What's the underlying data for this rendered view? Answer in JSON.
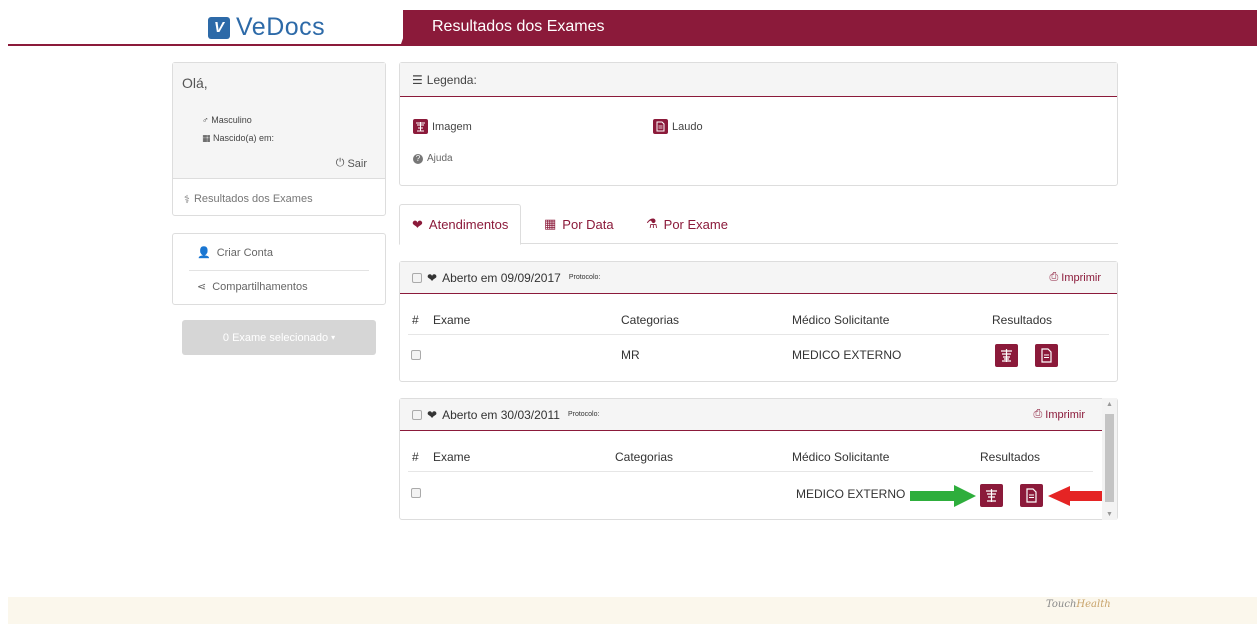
{
  "header": {
    "logo_text": "VeDocs",
    "page_title": "Resultados dos Exames",
    "accent_color": "#8b1a3a",
    "logo_color": "#2d6aa8"
  },
  "sidebar": {
    "greeting": "Olá,",
    "gender_label": "Masculino",
    "born_label": "Nascido(a) em:",
    "logout_label": "Sair",
    "results_link": "Resultados dos Exames",
    "menu": [
      {
        "label": "Criar Conta",
        "icon": "add-user-icon"
      },
      {
        "label": "Compartilhamentos",
        "icon": "share-icon"
      }
    ],
    "selected_button": "0 Exame selecionado"
  },
  "legend": {
    "title": "Legenda:",
    "items": [
      {
        "label": "Imagem",
        "icon": "image-icon"
      },
      {
        "label": "Laudo",
        "icon": "report-icon"
      },
      {
        "label": "Ajuda",
        "icon": "help-icon"
      }
    ]
  },
  "tabs": [
    {
      "label": "Atendimentos",
      "icon": "heartbeat-icon",
      "active": true
    },
    {
      "label": "Por Data",
      "icon": "calendar-icon",
      "active": false
    },
    {
      "label": "Por Exame",
      "icon": "flask-icon",
      "active": false
    }
  ],
  "cards": [
    {
      "title": "Aberto em 09/09/2017",
      "protocol_label": "Protocolo:",
      "print_label": "Imprimir",
      "columns": [
        "#",
        "Exame",
        "Categorias",
        "Médico Solicitante",
        "Resultados"
      ],
      "rows": [
        {
          "exam": "",
          "category": "MR",
          "doctor": "MEDICO EXTERNO"
        }
      ]
    },
    {
      "title": "Aberto em 30/03/2011",
      "protocol_label": "Protocolo:",
      "print_label": "Imprimir",
      "columns": [
        "#",
        "Exame",
        "Categorias",
        "Médico Solicitante",
        "Resultados"
      ],
      "rows": [
        {
          "exam": "",
          "category": "",
          "doctor": "MEDICO EXTERNO"
        }
      ]
    }
  ],
  "footer": {
    "brand": "TouchHealth",
    "brand_a": "Touch",
    "brand_b": "Health"
  }
}
